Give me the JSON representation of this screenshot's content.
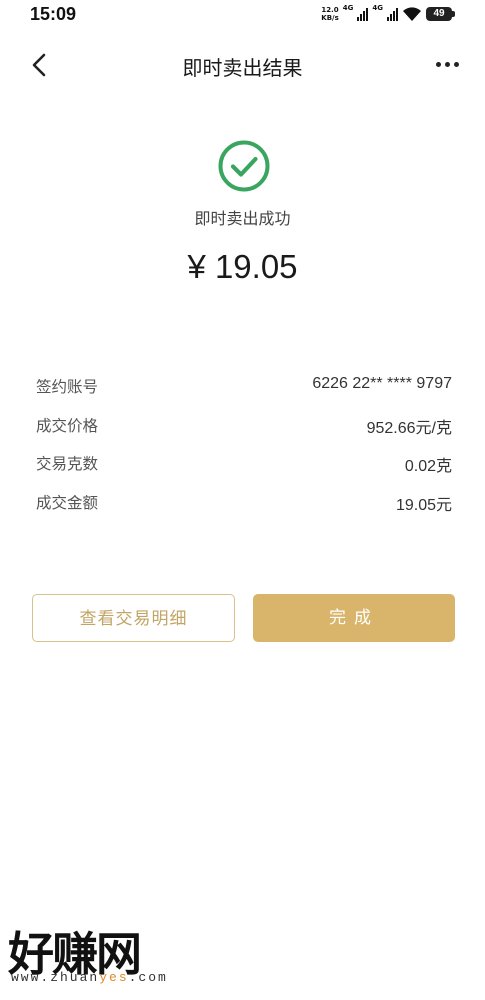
{
  "status_bar": {
    "time": "15:09",
    "net_speed_value": "12.0",
    "net_speed_unit": "KB/s",
    "network_1": "4G",
    "network_2": "4G",
    "battery": "49"
  },
  "nav": {
    "back_icon": "chevron-left-icon",
    "title": "即时卖出结果",
    "more_icon": "more-dots-icon"
  },
  "result": {
    "icon": "check-circle-icon",
    "status_text": "即时卖出成功",
    "amount": "¥ 19.05",
    "accent_color": "#3aa55f"
  },
  "details": [
    {
      "label": "签约账号",
      "value": "6226 22** **** 9797"
    },
    {
      "label": "成交价格",
      "value": "952.66元/克"
    },
    {
      "label": "交易克数",
      "value": "0.02克"
    },
    {
      "label": "成交金额",
      "value": "19.05元"
    }
  ],
  "buttons": {
    "view_detail": "查看交易明细",
    "done": "完成",
    "brand_color": "#d8b56a"
  },
  "watermark": {
    "brand": "好赚网",
    "url_prefix": "www.zhuan",
    "url_accent": "yes",
    "url_suffix": ".com"
  }
}
